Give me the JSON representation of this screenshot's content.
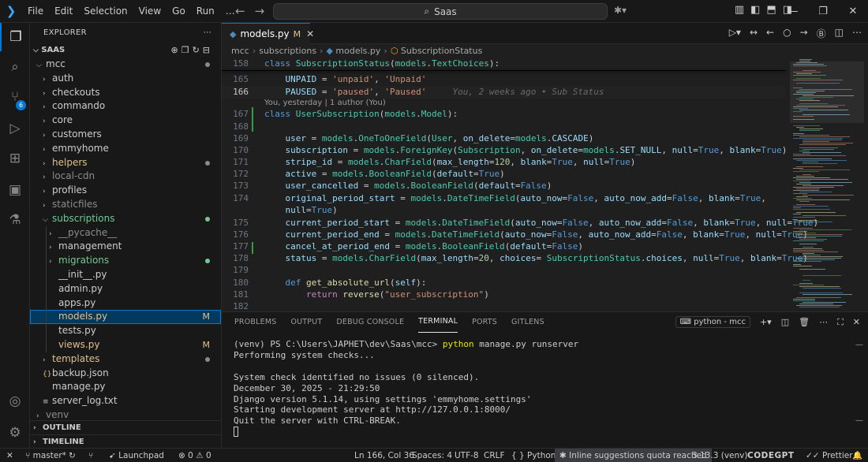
{
  "titlebar": {
    "menu": [
      "File",
      "Edit",
      "Selection",
      "View",
      "Go",
      "Run",
      "…"
    ],
    "search_text": "Saas"
  },
  "activity": {
    "scm_badge": "6"
  },
  "explorer": {
    "title": "EXPLORER",
    "root": "SAAS",
    "tree": [
      {
        "label": "mcc",
        "depth": 0,
        "type": "folder",
        "open": true,
        "dot": "#8a8a8a"
      },
      {
        "label": "auth",
        "depth": 1,
        "type": "folder"
      },
      {
        "label": "checkouts",
        "depth": 1,
        "type": "folder"
      },
      {
        "label": "commando",
        "depth": 1,
        "type": "folder"
      },
      {
        "label": "core",
        "depth": 1,
        "type": "folder"
      },
      {
        "label": "customers",
        "depth": 1,
        "type": "folder"
      },
      {
        "label": "emmyhome",
        "depth": 1,
        "type": "folder"
      },
      {
        "label": "helpers",
        "depth": 1,
        "type": "folder",
        "color": "#e2c08d",
        "dot": "#8a8a8a"
      },
      {
        "label": "local-cdn",
        "depth": 1,
        "type": "folder",
        "color": "#8c8c8c"
      },
      {
        "label": "profiles",
        "depth": 1,
        "type": "folder"
      },
      {
        "label": "staticfiles",
        "depth": 1,
        "type": "folder",
        "color": "#8c8c8c"
      },
      {
        "label": "subscriptions",
        "depth": 1,
        "type": "folder",
        "open": true,
        "color": "#73c991",
        "dot": "#73c991"
      },
      {
        "label": "__pycache__",
        "depth": 2,
        "type": "folder",
        "color": "#8c8c8c"
      },
      {
        "label": "management",
        "depth": 2,
        "type": "folder"
      },
      {
        "label": "migrations",
        "depth": 2,
        "type": "folder",
        "color": "#73c991",
        "dot": "#73c991"
      },
      {
        "label": "__init__.py",
        "depth": 2,
        "type": "file"
      },
      {
        "label": "admin.py",
        "depth": 2,
        "type": "file"
      },
      {
        "label": "apps.py",
        "depth": 2,
        "type": "file"
      },
      {
        "label": "models.py",
        "depth": 2,
        "type": "file",
        "selected": true,
        "mark": "M",
        "color": "#e2c08d"
      },
      {
        "label": "tests.py",
        "depth": 2,
        "type": "file"
      },
      {
        "label": "views.py",
        "depth": 2,
        "type": "file",
        "mark": "M",
        "color": "#e2c08d"
      },
      {
        "label": "templates",
        "depth": 1,
        "type": "folder",
        "color": "#e2c08d",
        "dot": "#8a8a8a"
      },
      {
        "label": "backup.json",
        "depth": 1,
        "type": "json"
      },
      {
        "label": "manage.py",
        "depth": 1,
        "type": "file"
      },
      {
        "label": "server_log.txt",
        "depth": 1,
        "type": "txt"
      },
      {
        "label": "venv",
        "depth": 0,
        "type": "folder",
        "color": "#8c8c8c"
      }
    ],
    "outline": "OUTLINE",
    "timeline": "TIMELINE"
  },
  "editor": {
    "tab": {
      "label": "models.py",
      "mark": "M"
    },
    "breadcrumb": [
      "mcc",
      "subscriptions",
      "models.py",
      "SubscriptionStatus"
    ],
    "codelens": "You, yesterday | 1 author (You)",
    "blame": "You, 2 weeks ago • Sub Status"
  },
  "panel": {
    "tabs": [
      "PROBLEMS",
      "OUTPUT",
      "DEBUG CONSOLE",
      "TERMINAL",
      "PORTS",
      "GITLENS"
    ],
    "active_tab": "TERMINAL",
    "shell": "python - mcc",
    "terminal": {
      "prompt": "(venv) PS C:\\Users\\JAPHET\\dev\\Saas\\mcc> ",
      "command": "python",
      "command_args": " manage.py runserver",
      "lines": [
        "Performing system checks...",
        "",
        "System check identified no issues (0 silenced).",
        "December 30, 2025 - 21:29:50",
        "Django version 5.1.14, using settings 'emmyhome.settings'",
        "Starting development server at http://127.0.0.1:8000/",
        "Quit the server with CTRL-BREAK."
      ]
    }
  },
  "statusbar": {
    "branch": "master*",
    "launchpad": "Launchpad",
    "errors": "0",
    "warnings": "0",
    "position": "Ln 166, Col 36",
    "spaces": "Spaces: 4",
    "encoding": "UTF-8",
    "eol": "CRLF",
    "language": "Python",
    "quota": "Inline suggestions quota reached",
    "interpreter": "3.13.3 (venv)",
    "codegpt": "CODEGPT",
    "prettier": "Prettier"
  },
  "colors": {
    "accent": "#0078d4",
    "modified": "#e2c08d",
    "untracked": "#73c991"
  }
}
